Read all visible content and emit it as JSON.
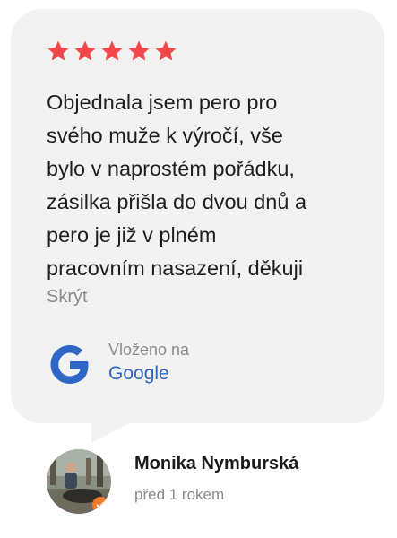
{
  "review": {
    "rating": 5,
    "star_color": "#f2474b",
    "text_lines": [
      "Objednala jsem pero pro",
      "svého muže k výročí, vše",
      "bylo v naprostém pořádku,",
      "zásilka přišla do dvou dnů a",
      "pero je již v plném",
      "pracovním nasazení, děkuji"
    ],
    "hide_label": "Skrýt"
  },
  "source": {
    "posted_label": "Vloženo na",
    "platform": "Google",
    "icon": "google-g-icon",
    "link_color": "#2c64c4"
  },
  "author": {
    "name": "Monika Nymburská",
    "time_ago": "před 1 rokem",
    "avatar_icon": "user-photo-avatar"
  }
}
